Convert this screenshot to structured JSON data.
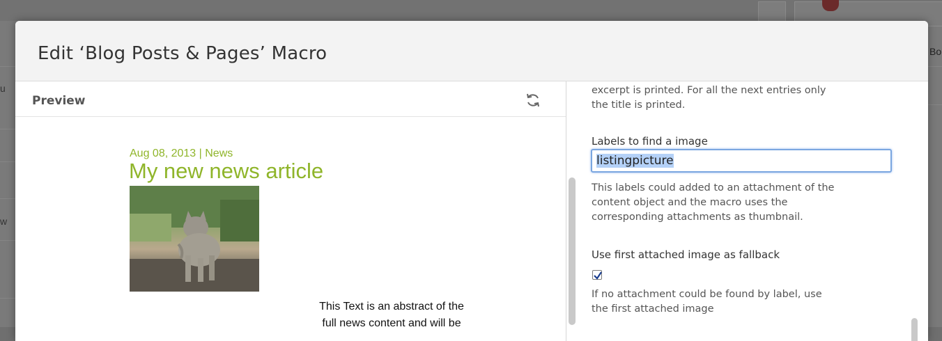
{
  "modal": {
    "title": "Edit ‘Blog Posts & Pages’ Macro"
  },
  "preview": {
    "label": "Preview",
    "refresh_icon": "refresh-icon",
    "article": {
      "meta": "Aug 08, 2013  | News",
      "title": "My new news article",
      "abstract_line1": "This Text is an abstract of the",
      "abstract_line2": "full news content and will be"
    }
  },
  "settings": {
    "excerpt_line1": "excerpt is printed. For all the next entries only",
    "excerpt_line2": "the title is printed.",
    "image_labels": {
      "label": "Labels to find a image",
      "value": "listingpicture",
      "help_line1": "This labels could added to an attachment of the",
      "help_line2": "content object and the macro uses the",
      "help_line3": "corresponding attachments as thumbnail."
    },
    "fallback": {
      "label": "Use first attached image as fallback",
      "checked": true,
      "help_line1": "If no attachment could be found by label, use",
      "help_line2": "the first attached image"
    }
  },
  "background": {
    "right_text": "Bo",
    "left_text_a": "u",
    "left_text_b": "w"
  },
  "colors": {
    "accent_green": "#8fb52a",
    "focus_blue": "#7aa6e0",
    "selection": "#b4d1f7"
  }
}
